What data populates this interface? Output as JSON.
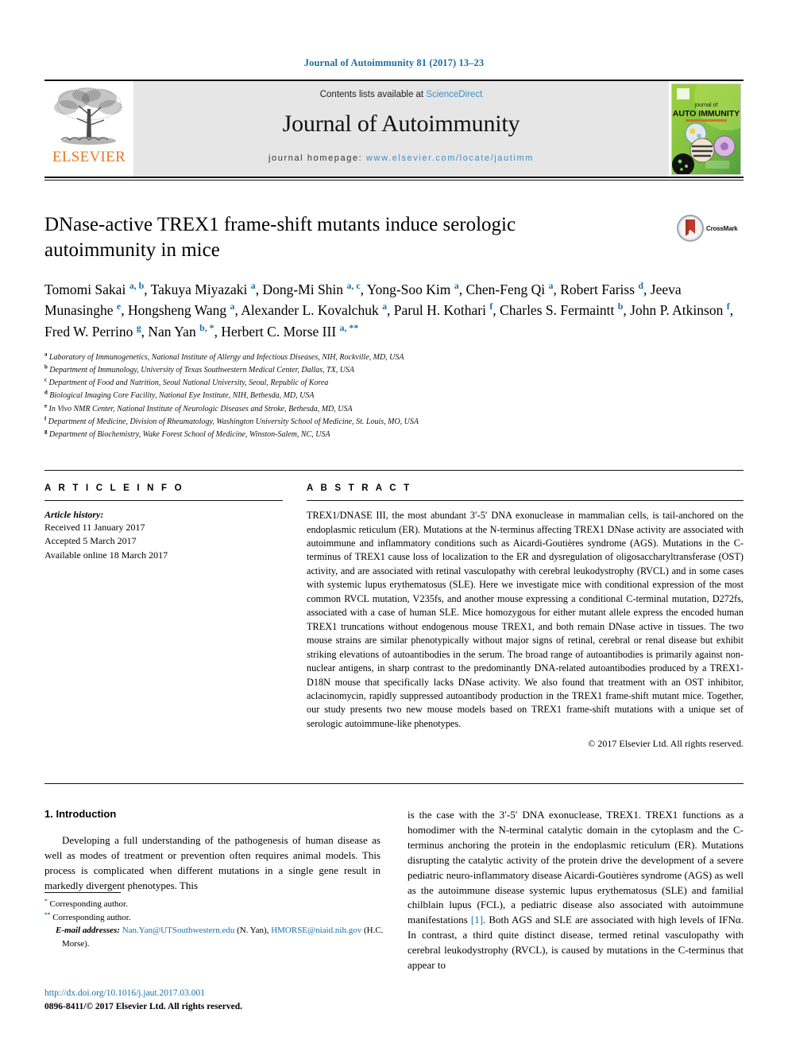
{
  "running_head": "Journal of Autoimmunity 81 (2017) 13–23",
  "masthead": {
    "publisher_name": "ELSEVIER",
    "publisher_logo_icon": "elsevier-tree-logo",
    "contents_prefix": "Contents lists available at ",
    "contents_link": "ScienceDirect",
    "journal_name": "Journal of Autoimmunity",
    "homepage_prefix": "journal homepage: ",
    "homepage_url": "www.elsevier.com/locate/jautimm",
    "cover_title_line1": "journal of",
    "cover_title_line2": "AUTO IMMUNITY"
  },
  "article": {
    "title": "DNase-active TREX1 frame-shift mutants induce serologic autoimmunity in mice",
    "crossmark_label": "CrossMark",
    "crossmark_icon": "crossmark-badge-icon",
    "authors_html": "Tomomi Sakai <sup>a, b</sup>, Takuya Miyazaki <sup>a</sup>, Dong-Mi Shin <sup>a, c</sup>, Yong-Soo Kim <sup>a</sup>, Chen-Feng Qi <sup>a</sup>, Robert Fariss <sup>d</sup>, Jeeva Munasinghe <sup>e</sup>, Hongsheng Wang <sup>a</sup>, Alexander L. Kovalchuk <sup>a</sup>, Parul H. Kothari <sup>f</sup>, Charles S. Fermaintt <sup>b</sup>, John P. Atkinson <sup>f</sup>, Fred W. Perrino <sup>g</sup>, Nan Yan <sup>b, *</sup>, Herbert C. Morse III <sup>a, **</sup>",
    "affiliations": [
      {
        "marker": "a",
        "text": "Laboratory of Immunogenetics, National Institute of Allergy and Infectious Diseases, NIH, Rockville, MD, USA"
      },
      {
        "marker": "b",
        "text": "Department of Immunology, University of Texas Southwestern Medical Center, Dallas, TX, USA"
      },
      {
        "marker": "c",
        "text": "Department of Food and Nutrition, Seoul National University, Seoul, Republic of Korea"
      },
      {
        "marker": "d",
        "text": "Biological Imaging Core Facility, National Eye Institute, NIH, Bethesda, MD, USA"
      },
      {
        "marker": "e",
        "text": "In Vivo NMR Center, National Institute of Neurologic Diseases and Stroke, Bethesda, MD, USA"
      },
      {
        "marker": "f",
        "text": "Department of Medicine, Division of Rheumatology, Washington University School of Medicine, St. Louis, MO, USA"
      },
      {
        "marker": "g",
        "text": "Department of Biochemistry, Wake Forest School of Medicine, Winston-Salem, NC, USA"
      }
    ]
  },
  "article_info": {
    "heading": "A R T I C L E  I N F O",
    "history_label": "Article history:",
    "received": "Received 11 January 2017",
    "accepted": "Accepted 5 March 2017",
    "available": "Available online 18 March 2017"
  },
  "abstract": {
    "heading": "A B S T R A C T",
    "text": "TREX1/DNASE III, the most abundant 3′-5′ DNA exonuclease in mammalian cells, is tail-anchored on the endoplasmic reticulum (ER). Mutations at the N-terminus affecting TREX1 DNase activity are associated with autoimmune and inflammatory conditions such as Aicardi-Goutières syndrome (AGS). Mutations in the C-terminus of TREX1 cause loss of localization to the ER and dysregulation of oligosaccharyltransferase (OST) activity, and are associated with retinal vasculopathy with cerebral leukodystrophy (RVCL) and in some cases with systemic lupus erythematosus (SLE). Here we investigate mice with conditional expression of the most common RVCL mutation, V235fs, and another mouse expressing a conditional C-terminal mutation, D272fs, associated with a case of human SLE. Mice homozygous for either mutant allele express the encoded human TREX1 truncations without endogenous mouse TREX1, and both remain DNase active in tissues. The two mouse strains are similar phenotypically without major signs of retinal, cerebral or renal disease but exhibit striking elevations of autoantibodies in the serum. The broad range of autoantibodies is primarily against non-nuclear antigens, in sharp contrast to the predominantly DNA-related autoantibodies produced by a TREX1-D18N mouse that specifically lacks DNase activity. We also found that treatment with an OST inhibitor, aclacinomycin, rapidly suppressed autoantibody production in the TREX1 frame-shift mutant mice. Together, our study presents two new mouse models based on TREX1 frame-shift mutations with a unique set of serologic autoimmune-like phenotypes.",
    "copyright": "© 2017 Elsevier Ltd. All rights reserved."
  },
  "introduction": {
    "heading": "1.  Introduction",
    "left_paragraph": "Developing a full understanding of the pathogenesis of human disease as well as modes of treatment or prevention often requires animal models. This process is complicated when different mutations in a single gene result in markedly divergent phenotypes. This",
    "right_paragraph_part1": "is the case with the 3′-5′ DNA exonuclease, TREX1. TREX1 functions as a homodimer with the N-terminal catalytic domain in the cytoplasm and the C-terminus anchoring the protein in the endoplasmic reticulum (ER). Mutations disrupting the catalytic activity of the protein drive the development of a severe pediatric neuro-inflammatory disease Aicardi-Goutières syndrome (AGS) as well as the autoimmune disease systemic lupus erythematosus (SLE) and familial chilblain lupus (FCL), a pediatric disease also associated with autoimmune manifestations ",
    "right_citation": "[1]",
    "right_paragraph_part2": ". Both AGS and SLE are associated with high levels of IFNα. In contrast, a third quite distinct disease, termed retinal vasculopathy with cerebral leukodystrophy (RVCL), is caused by mutations in the C-terminus that appear to"
  },
  "footnotes": {
    "corresponding_1": "Corresponding author.",
    "corresponding_2": "Corresponding author.",
    "email_label": "E-mail addresses:",
    "email_1": "Nan.Yan@UTSouthwestern.edu",
    "email_1_name": "(N. Yan),",
    "email_2": "HMORSE@niaid.nih.gov",
    "email_2_name": "(H.C. Morse)."
  },
  "footer": {
    "doi": "http://dx.doi.org/10.1016/j.jaut.2017.03.001",
    "issn": "0896-8411/© 2017 Elsevier Ltd. All rights reserved."
  },
  "colors": {
    "link_blue": "#1a6fa8",
    "science_direct_blue": "#3e8fc4",
    "elsevier_orange": "#E87722",
    "banner_grey": "#e6e6e6"
  }
}
